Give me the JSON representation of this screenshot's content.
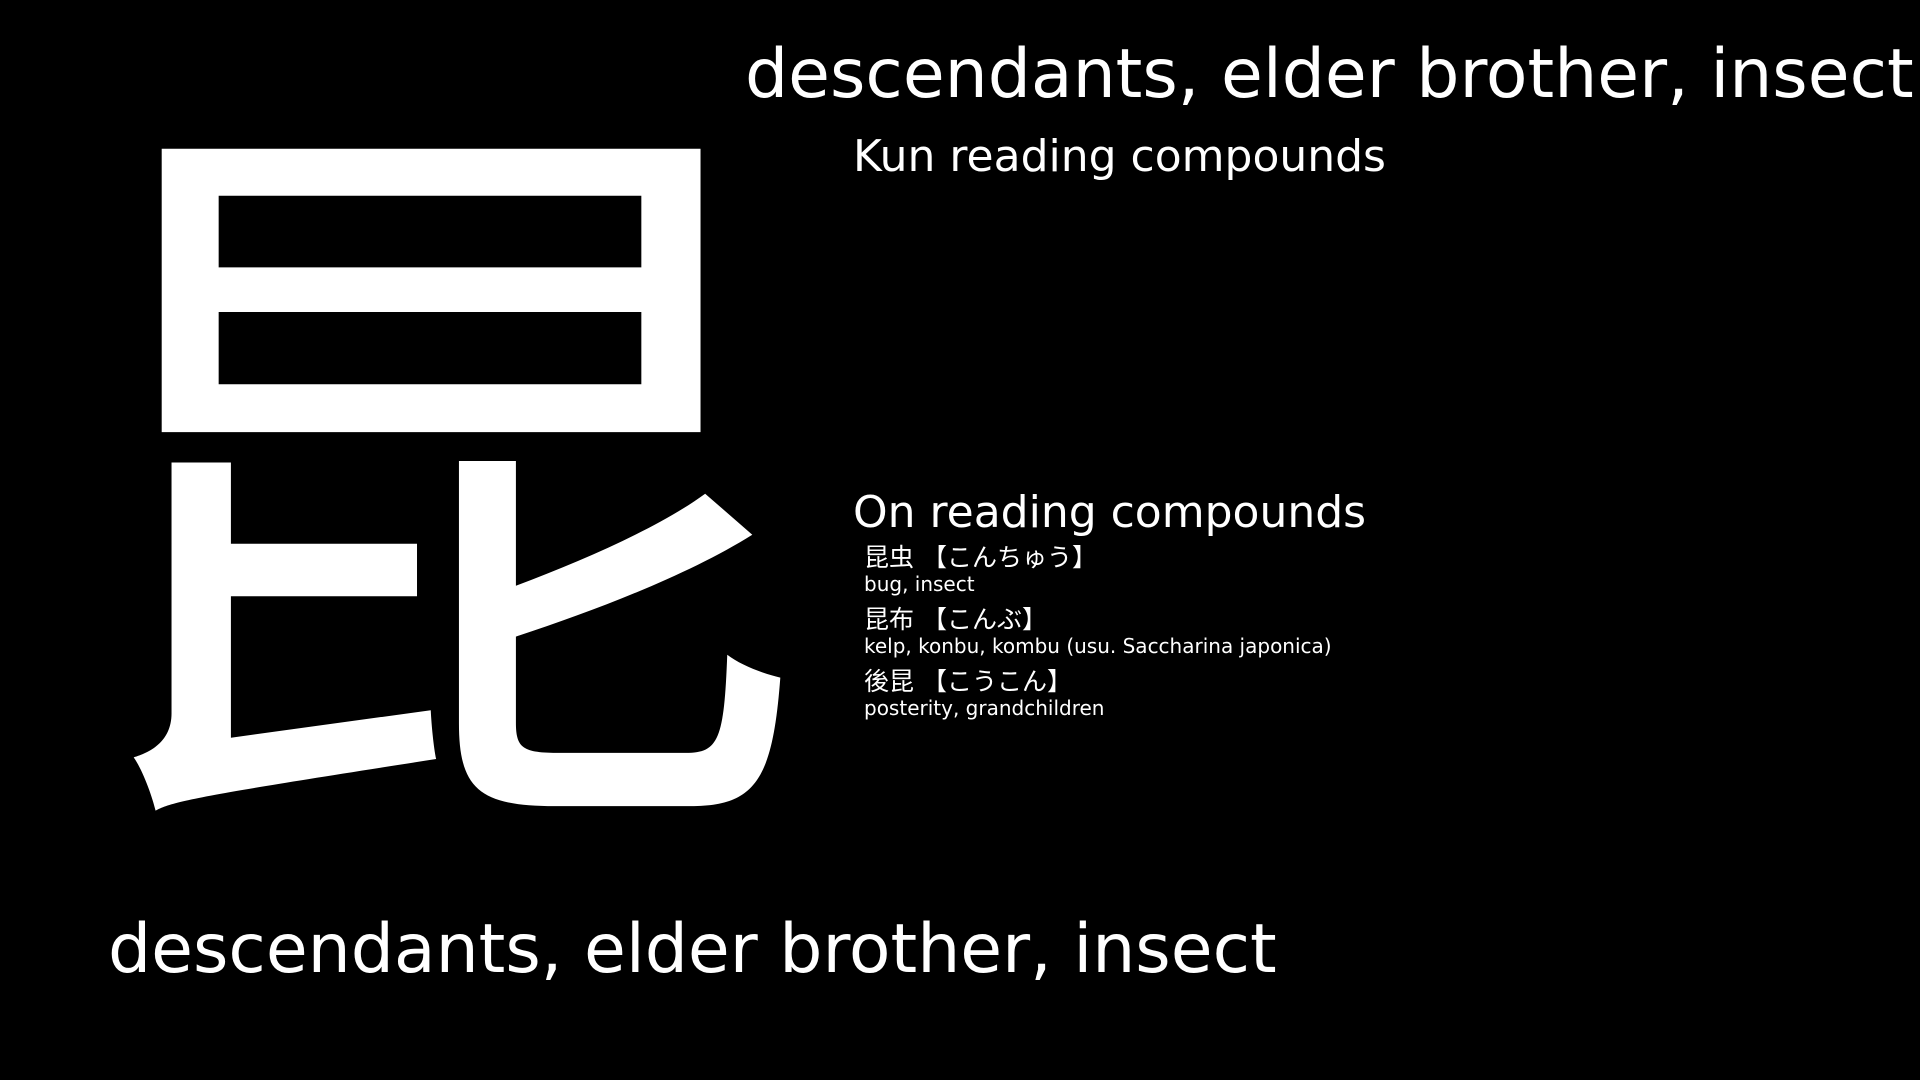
{
  "kanji": "昆",
  "meaning_top": "descendants, elder brother, insect",
  "meaning_bottom": "descendants, elder brother, insect",
  "kun_heading": "Kun reading compounds",
  "on_heading": "On reading compounds",
  "on_compounds": [
    {
      "word": "昆虫",
      "reading": "【こんちゅう】",
      "meaning": "bug, insect"
    },
    {
      "word": "昆布",
      "reading": "【こんぶ】",
      "meaning": "kelp, konbu, kombu (usu. Saccharina japonica)"
    },
    {
      "word": "後昆",
      "reading": "【こうこん】",
      "meaning": "posterity, grandchildren"
    }
  ],
  "colors": {
    "background": "#000000",
    "text": "#ffffff"
  }
}
